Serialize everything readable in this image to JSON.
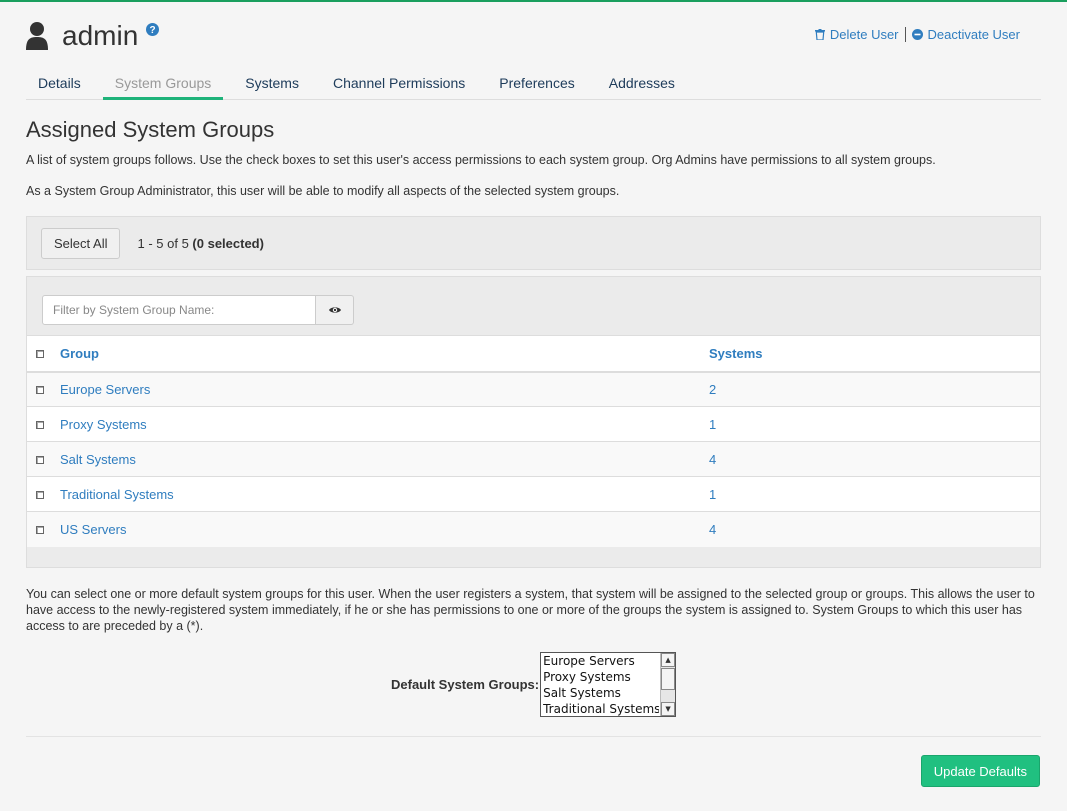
{
  "header": {
    "title": "admin",
    "actions": {
      "delete_user": "Delete User",
      "deactivate_user": "Deactivate User"
    }
  },
  "tabs": [
    {
      "label": "Details"
    },
    {
      "label": "System Groups",
      "active": true
    },
    {
      "label": "Systems"
    },
    {
      "label": "Channel Permissions"
    },
    {
      "label": "Preferences"
    },
    {
      "label": "Addresses"
    }
  ],
  "section": {
    "heading": "Assigned System Groups",
    "desc1": "A list of system groups follows. Use the check boxes to set this user's access permissions to each system group. Org Admins have permissions to all system groups.",
    "desc2": "As a System Group Administrator, this user will be able to modify all aspects of the selected system groups."
  },
  "toolbar": {
    "select_all": "Select All",
    "range": "1 - 5 of 5",
    "selected": "(0 selected)"
  },
  "filter": {
    "placeholder": "Filter by System Group Name:"
  },
  "table": {
    "columns": {
      "group": "Group",
      "systems": "Systems"
    },
    "rows": [
      {
        "group": "Europe Servers",
        "systems": "2"
      },
      {
        "group": "Proxy Systems",
        "systems": "1"
      },
      {
        "group": "Salt Systems",
        "systems": "4"
      },
      {
        "group": "Traditional Systems",
        "systems": "1"
      },
      {
        "group": "US Servers",
        "systems": "4"
      }
    ]
  },
  "defaults_info": "You can select one or more default system groups for this user. When the user registers a system, that system will be assigned to the selected group or groups. This allows the user to have access to the newly-registered system immediately, if he or she has permissions to one or more of the groups the system is assigned to. System Groups to which this user has access to are preceded by a (*).",
  "default_groups": {
    "label": "Default System Groups:",
    "options": [
      "Europe Servers",
      "Proxy Systems",
      "Salt Systems",
      "Traditional Systems"
    ]
  },
  "update_button": "Update Defaults",
  "colors": {
    "accent": "#20c080",
    "link": "#2f7dbf",
    "top_border": "#1a9f5e"
  }
}
